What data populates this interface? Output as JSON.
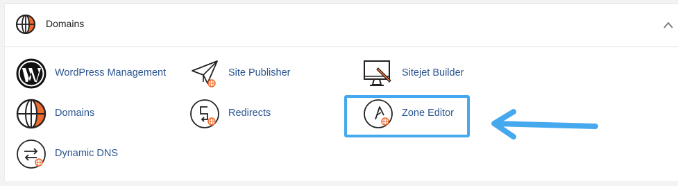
{
  "section": {
    "title": "Domains",
    "header_icon": "globe-icon",
    "collapse_icon": "chevron-up-icon"
  },
  "items": [
    {
      "label": "WordPress Management",
      "icon": "wordpress-icon"
    },
    {
      "label": "Site Publisher",
      "icon": "paper-plane-icon"
    },
    {
      "label": "Sitejet Builder",
      "icon": "monitor-pencil-icon"
    },
    {
      "label": "Domains",
      "icon": "globe-icon"
    },
    {
      "label": "Redirects",
      "icon": "redirect-icon"
    },
    {
      "label": "Zone Editor",
      "icon": "zone-compass-icon"
    },
    {
      "label": "Dynamic DNS",
      "icon": "dynamic-dns-icon"
    }
  ],
  "colors": {
    "link": "#2a5591",
    "accent_orange": "#ee6b2e",
    "highlight_blue": "#46a9ee"
  }
}
